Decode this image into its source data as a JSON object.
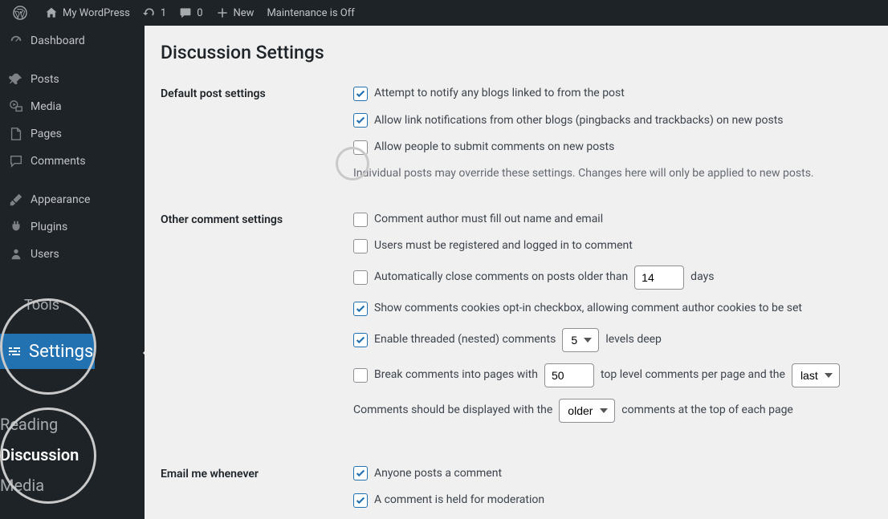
{
  "adminbar": {
    "site_name": "My WordPress",
    "updates_count": "1",
    "comments_count": "0",
    "new_label": "New",
    "maintenance": "Maintenance is Off"
  },
  "sidebar": {
    "items": [
      {
        "label": "Dashboard"
      },
      {
        "label": "Posts"
      },
      {
        "label": "Media"
      },
      {
        "label": "Pages"
      },
      {
        "label": "Comments"
      },
      {
        "label": "Appearance"
      },
      {
        "label": "Plugins"
      },
      {
        "label": "Users"
      },
      {
        "label": "Tools"
      },
      {
        "label": "Settings"
      }
    ],
    "submenu": {
      "reading": "Reading",
      "discussion": "Discussion",
      "media": "Media"
    }
  },
  "page": {
    "title": "Discussion Settings",
    "sections": {
      "default_post": {
        "heading": "Default post settings",
        "opt1": "Attempt to notify any blogs linked to from the post",
        "opt2": "Allow link notifications from other blogs (pingbacks and trackbacks) on new posts",
        "opt3": "Allow people to submit comments on new posts",
        "note": "Individual posts may override these settings. Changes here will only be applied to new posts."
      },
      "other_comment": {
        "heading": "Other comment settings",
        "opt1": "Comment author must fill out name and email",
        "opt2": "Users must be registered and logged in to comment",
        "opt3_pre": "Automatically close comments on posts older than",
        "opt3_val": "14",
        "opt3_post": "days",
        "opt4": "Show comments cookies opt-in checkbox, allowing comment author cookies to be set",
        "opt5_pre": "Enable threaded (nested) comments",
        "opt5_sel": "5",
        "opt5_post": "levels deep",
        "opt6_pre": "Break comments into pages with",
        "opt6_val": "50",
        "opt6_mid": "top level comments per page and the",
        "opt6_sel": "last",
        "opt7_pre": "Comments should be displayed with the",
        "opt7_sel": "older",
        "opt7_post": "comments at the top of each page"
      },
      "email_me": {
        "heading": "Email me whenever",
        "opt1": "Anyone posts a comment",
        "opt2": "A comment is held for moderation"
      }
    }
  }
}
